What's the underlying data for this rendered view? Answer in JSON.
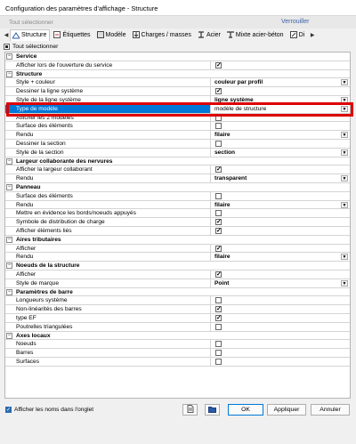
{
  "window": {
    "title": "Configuration des paramètres d'affichage - Structure"
  },
  "selection_bar": {
    "left": "Tout sélectionner",
    "right": "Verrouiller"
  },
  "tabs": [
    {
      "label": "Structure",
      "icon": "structure-icon",
      "active": true
    },
    {
      "label": "Étiquettes",
      "icon": "labels-icon"
    },
    {
      "label": "Modèle",
      "icon": "model-icon"
    },
    {
      "label": "Charges / masses",
      "icon": "loads-icon"
    },
    {
      "label": "Acier",
      "icon": "steel-icon"
    },
    {
      "label": "Mixte acier-béton",
      "icon": "composite-icon"
    },
    {
      "label": "Di",
      "icon": "dimension-icon"
    }
  ],
  "select_all_label": "Tout sélectionner",
  "grid": {
    "rows": [
      {
        "type": "cat",
        "label": "Service"
      },
      {
        "type": "item",
        "label": "Afficher lors de l'ouverture du service",
        "checkbox": true,
        "checked": true
      },
      {
        "type": "cat",
        "label": "Structure"
      },
      {
        "type": "item",
        "label": "Style + couleur",
        "value": "couleur par profil",
        "dropdown": true
      },
      {
        "type": "item",
        "label": "Dessiner la ligne système",
        "checkbox": true,
        "checked": true
      },
      {
        "type": "item",
        "label": "Style de la ligne système",
        "value": "ligne système",
        "dropdown": true
      },
      {
        "type": "item",
        "label": "Type de modèle",
        "value": "modèle de structure",
        "dropdown": true,
        "highlight": true
      },
      {
        "type": "item",
        "label": "Afficher les 2 modèles",
        "checkbox": true,
        "checked": false
      },
      {
        "type": "item",
        "label": "Surface des éléments",
        "checkbox": true,
        "checked": false
      },
      {
        "type": "item",
        "label": "Rendu",
        "value": "filaire",
        "dropdown": true
      },
      {
        "type": "item",
        "label": "Dessiner la section",
        "checkbox": true,
        "checked": false
      },
      {
        "type": "item",
        "label": "Style de la section",
        "value": "section",
        "dropdown": true
      },
      {
        "type": "cat",
        "label": "Largeur collaborante des nervures"
      },
      {
        "type": "item",
        "label": "Afficher la largeur collaborant",
        "checkbox": true,
        "checked": true
      },
      {
        "type": "item",
        "label": "Rendu",
        "value": "transparent",
        "dropdown": true
      },
      {
        "type": "cat",
        "label": "Panneau"
      },
      {
        "type": "item",
        "label": "Surface des éléments",
        "checkbox": true,
        "checked": false
      },
      {
        "type": "item",
        "label": "Rendu",
        "value": "filaire",
        "dropdown": true
      },
      {
        "type": "item",
        "label": "Mettre en évidence les bords/noeuds appuyés",
        "checkbox": true,
        "checked": false
      },
      {
        "type": "item",
        "label": "Symbole de distribution de charge",
        "checkbox": true,
        "checked": true
      },
      {
        "type": "item",
        "label": "Afficher éléments liés",
        "checkbox": true,
        "checked": true
      },
      {
        "type": "cat",
        "label": "Aires tributaires"
      },
      {
        "type": "item",
        "label": "Afficher",
        "checkbox": true,
        "checked": true
      },
      {
        "type": "item",
        "label": "Rendu",
        "value": "filaire",
        "dropdown": true
      },
      {
        "type": "cat",
        "label": "Noeuds de la structure"
      },
      {
        "type": "item",
        "label": "Afficher",
        "checkbox": true,
        "checked": true
      },
      {
        "type": "item",
        "label": "Style de marque",
        "value": "Point",
        "dropdown": true
      },
      {
        "type": "cat",
        "label": "Paramètres de barre"
      },
      {
        "type": "item",
        "label": "Longueurs système",
        "checkbox": true,
        "checked": false
      },
      {
        "type": "item",
        "label": "Non-linéarités des barres",
        "checkbox": true,
        "checked": true
      },
      {
        "type": "item",
        "label": "type EF",
        "checkbox": true,
        "checked": true
      },
      {
        "type": "item",
        "label": "Poutrelles triangulées",
        "checkbox": true,
        "checked": false
      },
      {
        "type": "cat",
        "label": "Axes locaux"
      },
      {
        "type": "item",
        "label": "Noeuds",
        "checkbox": true,
        "checked": false
      },
      {
        "type": "item",
        "label": "Barres",
        "checkbox": true,
        "checked": false
      },
      {
        "type": "item",
        "label": "Surfaces",
        "checkbox": true,
        "checked": false
      }
    ]
  },
  "footer": {
    "show_tab_names_label": "Afficher les noms dans l'onglet",
    "show_tab_names_checked": true,
    "buttons": {
      "ok": "OK",
      "apply": "Appliquer",
      "cancel": "Annuler"
    }
  },
  "colors": {
    "selection": "#0078d7",
    "highlight_border": "#d00000",
    "link": "#3c63a8"
  }
}
